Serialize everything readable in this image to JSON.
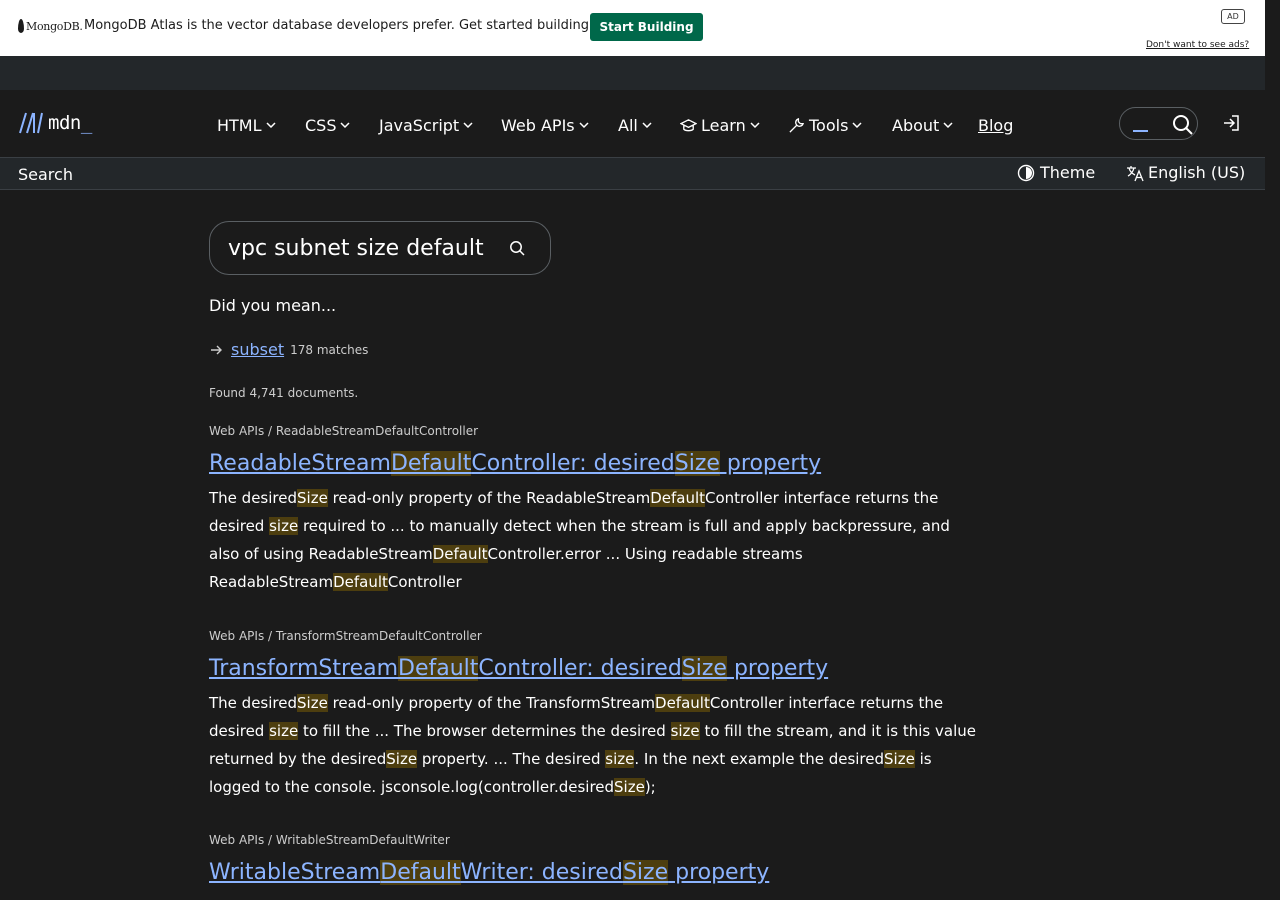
{
  "ad": {
    "brand": "MongoDB.",
    "text": "MongoDB Atlas is the vector database developers prefer. Get started building for free.",
    "cta": "Start Building",
    "badge": "AD",
    "hide": "Don't want to see ads?"
  },
  "nav": {
    "logo_text": "mdn",
    "logo_underscore": "_",
    "items": [
      "HTML",
      "CSS",
      "JavaScript",
      "Web APIs",
      "All",
      "Learn",
      "Tools",
      "About"
    ],
    "blog": "Blog"
  },
  "subbar": {
    "title": "Search",
    "theme": "Theme",
    "language": "English (US)"
  },
  "search": {
    "query": "vpc subnet size default",
    "did_you_mean": "Did you mean...",
    "suggestion": "subset",
    "suggestion_count": "178 matches",
    "found": "Found 4,741 documents."
  },
  "results": [
    {
      "crumb": "Web APIs / ReadableStreamDefaultController",
      "title": "ReadableStream<mark>Default</mark>Controller: desired<mark>Size</mark> property",
      "text": "The desired<mark>Size</mark> read-only property of the ReadableStream<mark>Default</mark>Controller interface returns the desired <mark>size</mark> required to ... to manually detect when the stream is full and apply backpressure, and also of using ReadableStream<mark>Default</mark>Controller.error ... Using readable streams ReadableStream<mark>Default</mark>Controller"
    },
    {
      "crumb": "Web APIs / TransformStreamDefaultController",
      "title": "TransformStream<mark>Default</mark>Controller: desired<mark>Size</mark> property",
      "text": "The desired<mark>Size</mark> read-only property of the TransformStream<mark>Default</mark>Controller interface returns the desired <mark>size</mark> to fill the ... The browser determines the desired <mark>size</mark> to fill the stream, and it is this value returned by the desired<mark>Size</mark> property. ... The desired <mark>size</mark>. In the next example the desired<mark>Size</mark> is logged to the console. jsconsole.log(controller.desired<mark>Size</mark>);"
    },
    {
      "crumb": "Web APIs / WritableStreamDefaultWriter",
      "title": "WritableStream<mark>Default</mark>Writer: desired<mark>Size</mark> property",
      "text": ""
    }
  ],
  "colors": {
    "background": "#1b1b1b",
    "link": "#8cb4ff",
    "highlight": "#4d3e0f",
    "ad_button": "#00684a"
  }
}
